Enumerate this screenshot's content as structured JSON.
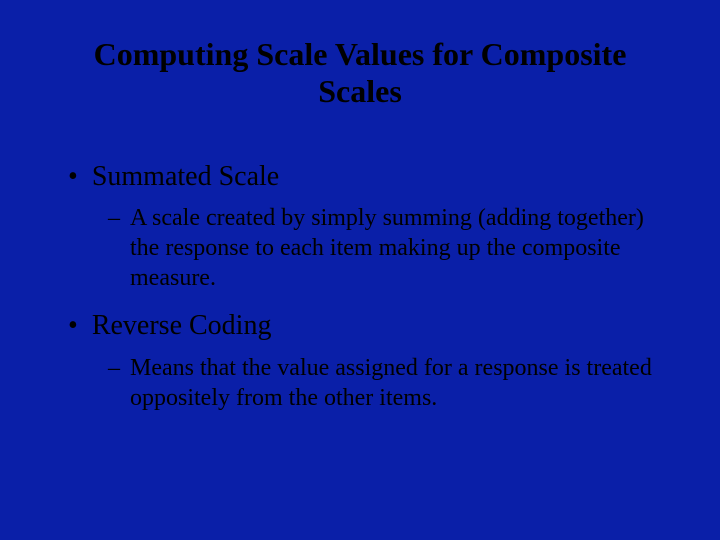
{
  "slide": {
    "title": "Computing Scale Values for Composite Scales",
    "bullets": [
      {
        "text": "Summated Scale",
        "sub": [
          "A scale created by simply summing (adding together) the response to each item making up the composite measure."
        ]
      },
      {
        "text": "Reverse Coding",
        "sub": [
          "Means that the value assigned for a response is treated oppositely from the other items."
        ]
      }
    ]
  },
  "glyphs": {
    "l1": "•",
    "l2": "–"
  }
}
